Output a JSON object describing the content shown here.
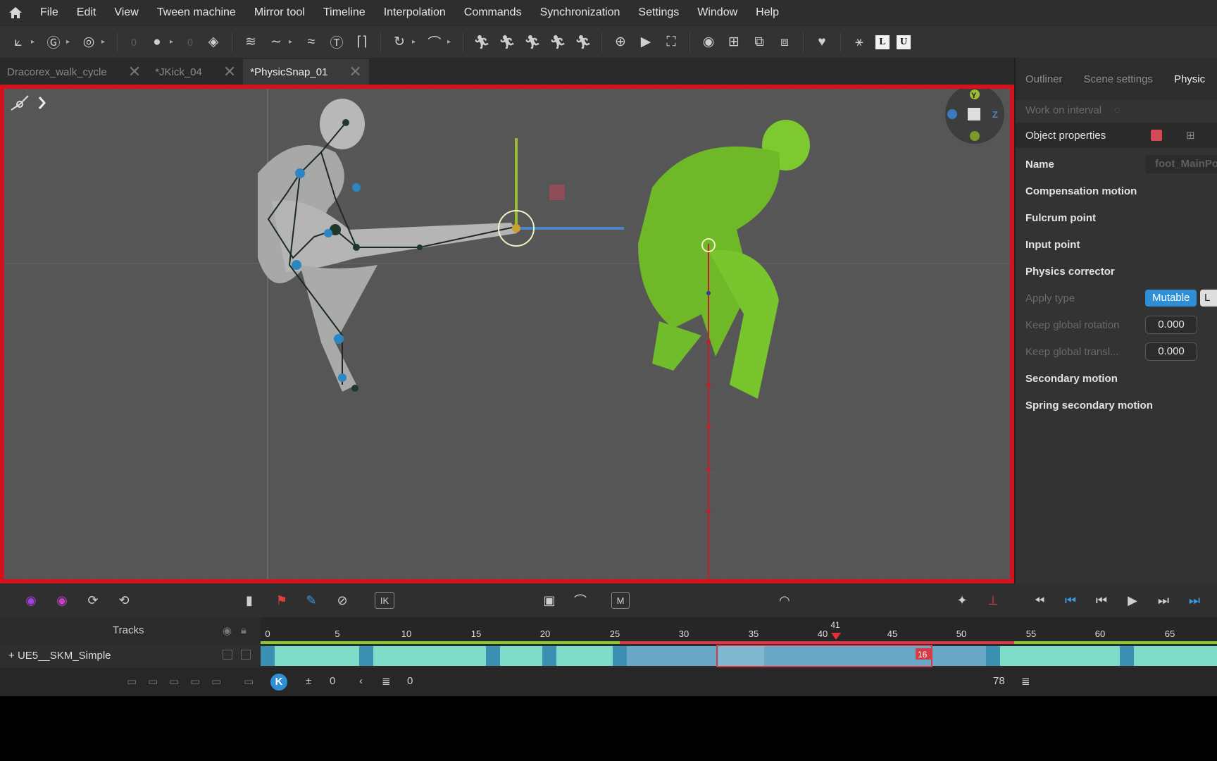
{
  "menubar": {
    "items": [
      "File",
      "Edit",
      "View",
      "Tween machine",
      "Mirror tool",
      "Timeline",
      "Interpolation",
      "Commands",
      "Synchronization",
      "Settings",
      "Window",
      "Help"
    ]
  },
  "toolbar": {
    "num1": "0",
    "num2": "0",
    "box_l": "L",
    "box_u": "U"
  },
  "tabs": [
    {
      "label": "Dracorex_walk_cycle",
      "active": false
    },
    {
      "label": "*JKick_04",
      "active": false
    },
    {
      "label": "*PhysicSnap_01",
      "active": true
    }
  ],
  "viewport": {
    "gizmo_y": "Y",
    "gizmo_z": "Z"
  },
  "panel": {
    "tabs": [
      "Outliner",
      "Scene settings",
      "Physic"
    ],
    "work_on_interval": "Work on interval",
    "object_properties": "Object properties",
    "name_label": "Name",
    "name_value": "foot_MainPo",
    "sections": [
      "Compensation motion",
      "Fulcrum point",
      "Input point",
      "Physics corrector"
    ],
    "apply_type_label": "Apply type",
    "apply_type_value": "Mutable",
    "apply_type_alt": "L",
    "keep_rot_label": "Keep global rotation",
    "keep_rot_value": "0.000",
    "keep_trans_label": "Keep global transl...",
    "keep_trans_value": "0.000",
    "secondary": "Secondary motion",
    "spring": "Spring secondary motion"
  },
  "controls": {
    "ik_label": "IK",
    "m_label": "M"
  },
  "timeline": {
    "tracks_label": "Tracks",
    "track_name": "UE5__SKM_Simple",
    "ticks": [
      "0",
      "5",
      "10",
      "15",
      "20",
      "25",
      "30",
      "35",
      "40",
      "45",
      "50",
      "55",
      "60",
      "65"
    ],
    "playhead_frame": "41",
    "range_end_badge": "16",
    "current_frame": "0",
    "frame_field": "0",
    "end_frame": "78",
    "key_button": "K"
  }
}
